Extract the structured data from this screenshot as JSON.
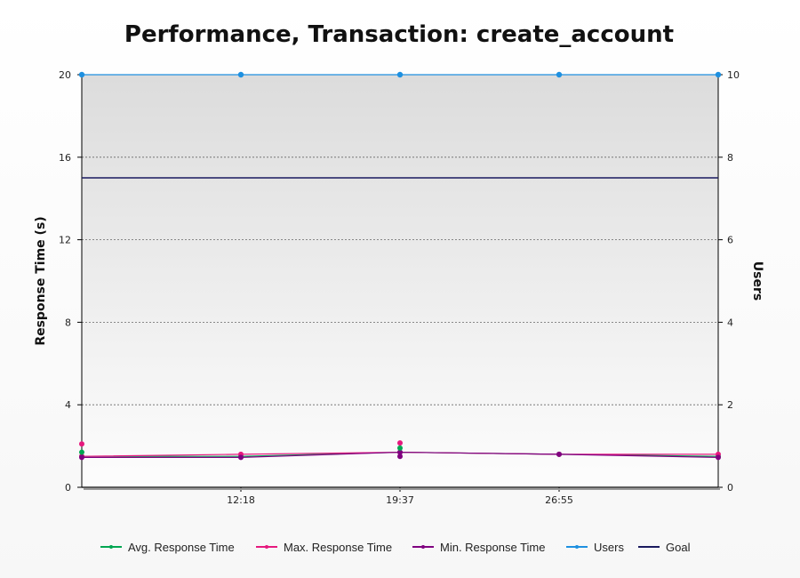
{
  "chart_data": {
    "type": "line",
    "title": "Performance, Transaction: create_account",
    "ylabel": "Response Time (s)",
    "y2label": "Users",
    "ylim": [
      0,
      20
    ],
    "y2lim": [
      0,
      10
    ],
    "y_ticks": [
      "0",
      "4",
      "8",
      "12",
      "16",
      "20"
    ],
    "y2_ticks": [
      "0",
      "2",
      "4",
      "6",
      "8",
      "10"
    ],
    "x_tick_labels": [
      "12:18",
      "19:37",
      "26:55"
    ],
    "grid": true,
    "legend_position": "bottom",
    "x_index": [
      0,
      1,
      2,
      3,
      4
    ],
    "x_tick_index": [
      1,
      2,
      3
    ],
    "series": [
      {
        "name": "Avg. Response Time",
        "axis": "left",
        "color": "#00a651",
        "values": [
          1.5,
          1.5,
          1.7,
          1.6,
          1.5
        ]
      },
      {
        "name": "Max. Response Time",
        "axis": "left",
        "color": "#e6197e",
        "values": [
          1.5,
          1.6,
          1.7,
          1.6,
          1.6
        ]
      },
      {
        "name": "Min. Response Time",
        "axis": "left",
        "color": "#800080",
        "values": [
          1.45,
          1.45,
          1.7,
          1.6,
          1.45
        ]
      },
      {
        "name": "Users",
        "axis": "right",
        "color": "#1e90e0",
        "values": [
          10,
          10,
          10,
          10,
          10
        ]
      },
      {
        "name": "Goal",
        "axis": "left",
        "color": "#1a1a5e",
        "values": [
          15,
          15,
          15,
          15,
          15
        ]
      }
    ],
    "extra_points": [
      {
        "series": "Max. Response Time",
        "x": 0,
        "y": 2.1
      },
      {
        "series": "Avg. Response Time",
        "x": 0,
        "y": 1.7
      },
      {
        "series": "Max. Response Time",
        "x": 2,
        "y": 2.15
      },
      {
        "series": "Avg. Response Time",
        "x": 2,
        "y": 1.9
      },
      {
        "series": "Min. Response Time",
        "x": 2,
        "y": 1.5
      }
    ]
  }
}
